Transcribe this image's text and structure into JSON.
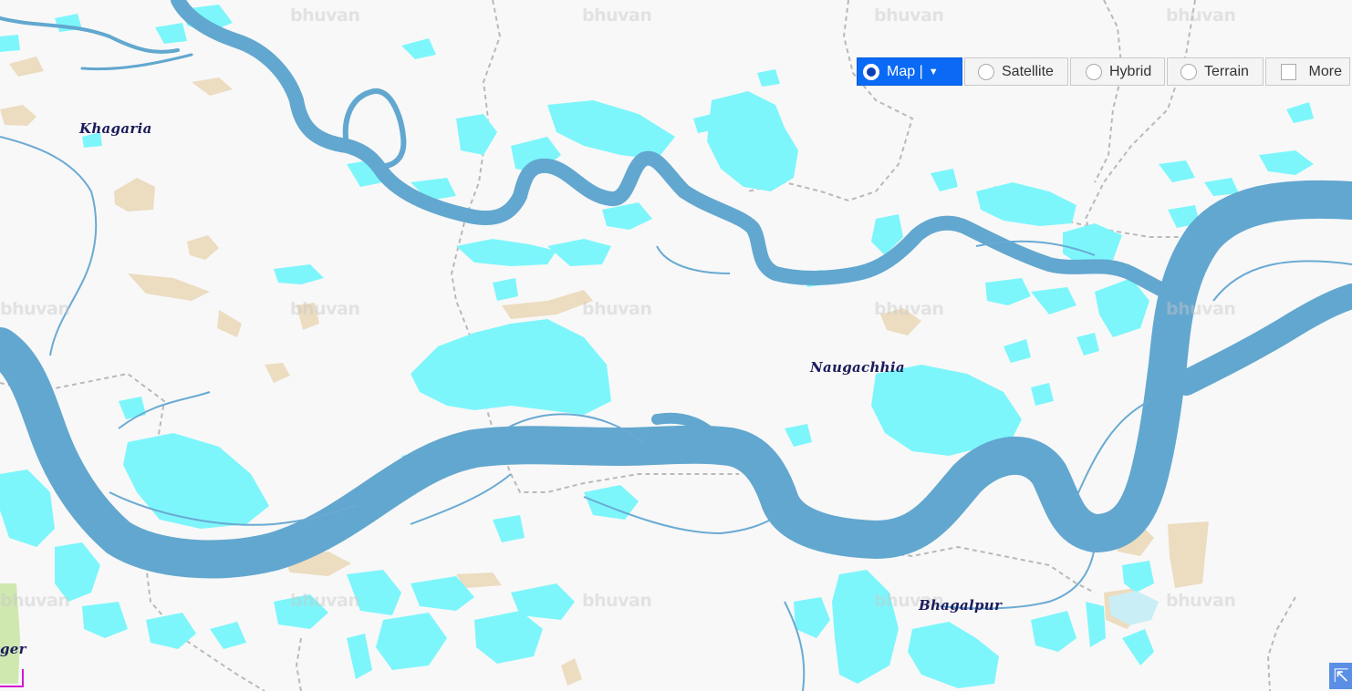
{
  "map": {
    "places": [
      {
        "id": "khagaria",
        "label": "Khagaria"
      },
      {
        "id": "naugachhia",
        "label": "Naugachhia"
      },
      {
        "id": "bhagalpur",
        "label": "Bhagalpur"
      },
      {
        "id": "munger-partial",
        "label": "ger"
      }
    ],
    "watermark": "bhuvan",
    "colors": {
      "background": "#f8f8f8",
      "river": "#62a7cf",
      "flood_water": "#7df6fb",
      "settlement": "#ecdcc0",
      "boundary": "#b4b4b4"
    }
  },
  "controls": {
    "map": {
      "label": "Map |",
      "caret": "▼"
    },
    "satellite": {
      "label": "Satellite"
    },
    "hybrid": {
      "label": "Hybrid"
    },
    "terrain": {
      "label": "Terrain"
    },
    "more": {
      "label": "More"
    },
    "selected": "map"
  },
  "corner_icon": "expand-arrow-icon"
}
